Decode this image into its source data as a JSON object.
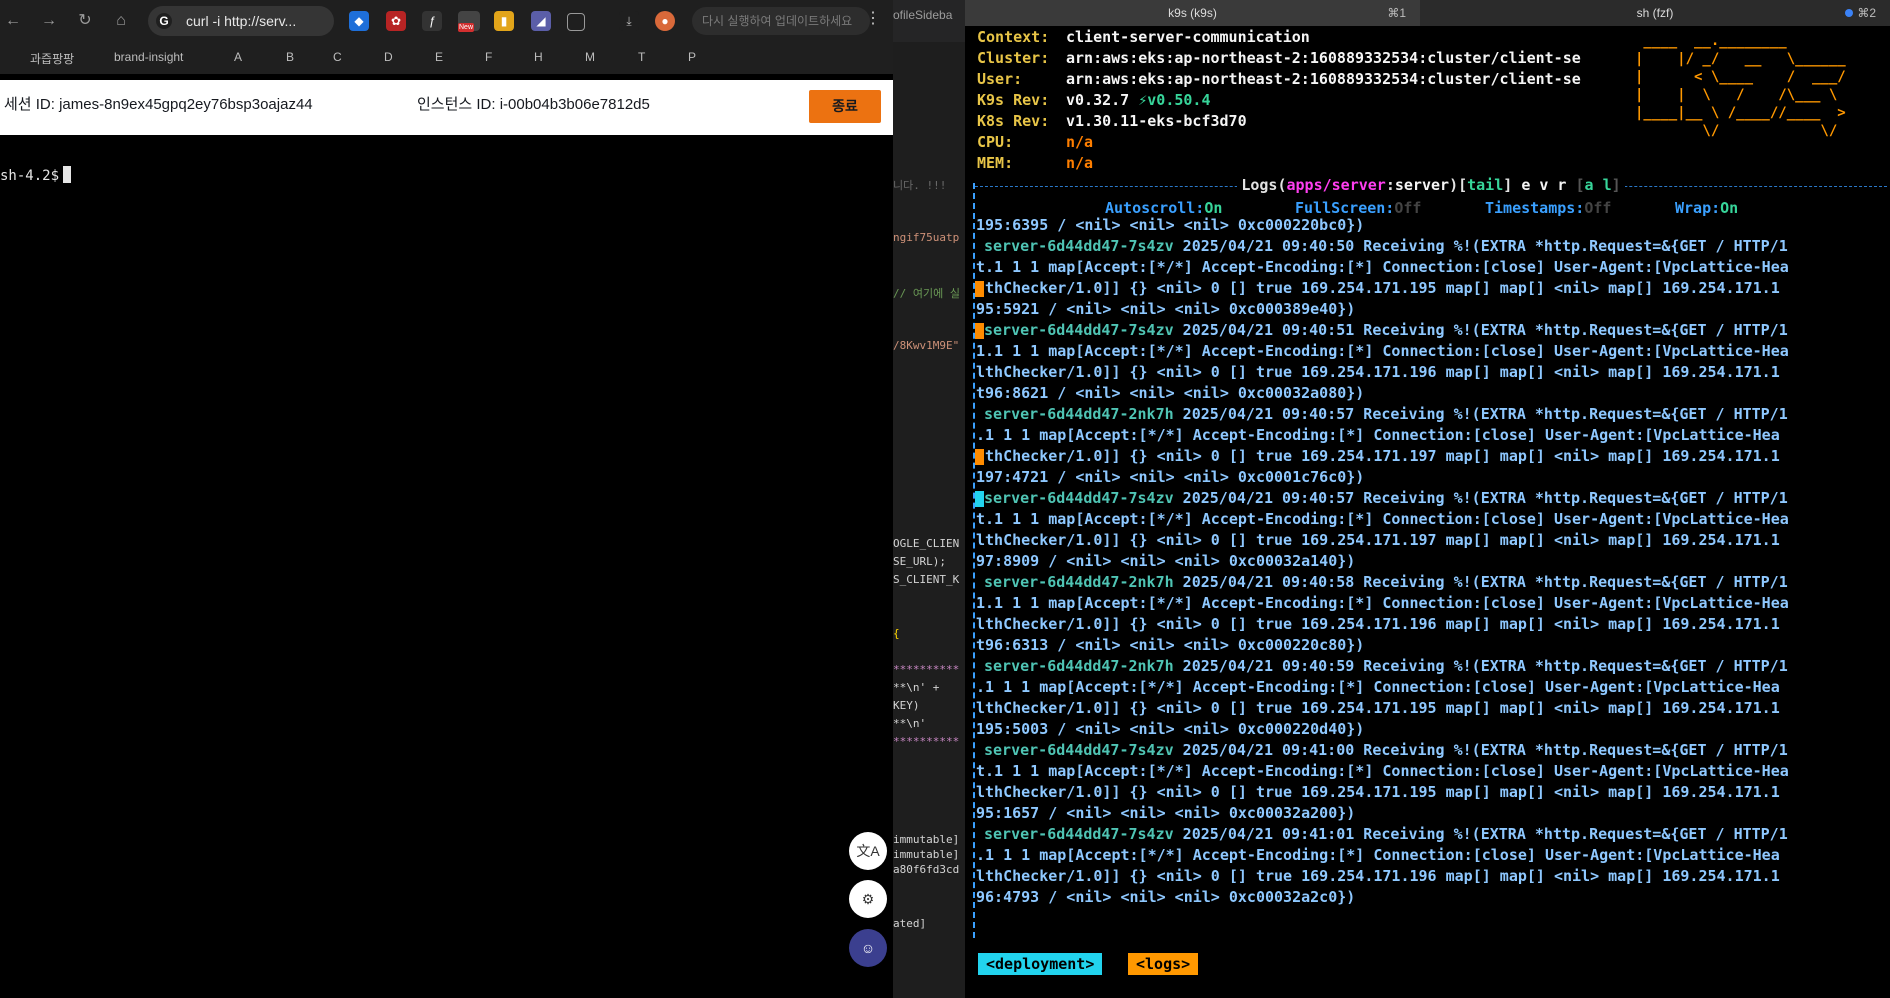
{
  "browser": {
    "address_text": "curl -i http://serv...",
    "ai_search_placeholder": "다시 실행하여 업데이트하세요",
    "bookmarks": [
      "과즙팡팡",
      "brand-insight",
      "A",
      "B",
      "C",
      "D",
      "E",
      "F",
      "H",
      "M",
      "T",
      "P"
    ],
    "new_badge": "New",
    "session_id": "세션 ID: james-8n9ex45gpq2ey76bsp3oajaz44",
    "instance_id": "인스턴스 ID: i-00b04b3b06e7812d5",
    "end_button": "종료",
    "shell_prompt": "sh-4.2$",
    "fab_icons": [
      "translate-icon",
      "extensions-icon",
      "assistant-icon"
    ]
  },
  "editor": {
    "tab_fragment": "ofileSideba",
    "lines": [
      {
        "text": "니다. !!!",
        "color": "#6a6a6a"
      },
      {
        "text": "ngif75uatp",
        "color": "#ce9178"
      },
      {
        "text": "// 여기에 실",
        "color": "#6a9955"
      },
      {
        "text": "/8Kwv1M9E\"",
        "color": "#ce9178"
      },
      {
        "text": "OGLE_CLIEN",
        "color": "#d4d4d4"
      },
      {
        "text": "SE_URL);",
        "color": "#d4d4d4"
      },
      {
        "text": "S_CLIENT_K",
        "color": "#d4d4d4"
      },
      {
        "text": "{",
        "color": "#ffd700"
      },
      {
        "text": "**********",
        "color": "#c586c0"
      },
      {
        "text": "  **\\n' +",
        "color": "#d4d4d4"
      },
      {
        "text": "KEY)",
        "color": "#d4d4d4"
      },
      {
        "text": "    **\\n'",
        "color": "#d4d4d4"
      },
      {
        "text": "**********",
        "color": "#c586c0"
      },
      {
        "text": "immutable]",
        "color": "#d4d4d4"
      },
      {
        "text": "immutable]",
        "color": "#d4d4d4"
      },
      {
        "text": "a80f6fd3cd",
        "color": "#d4d4d4"
      },
      {
        "text": "ated]",
        "color": "#d4d4d4"
      }
    ]
  },
  "terminal": {
    "tabs": [
      {
        "name": "k9s (k9s)",
        "shortcut": "⌘1"
      },
      {
        "name": "sh (fzf)",
        "shortcut": "⌘2"
      }
    ],
    "header": {
      "context_label": "Context:",
      "context": "client-server-communication",
      "cluster_label": "Cluster:",
      "cluster": "arn:aws:eks:ap-northeast-2:160889332534:cluster/client-se",
      "user_label": "User:",
      "user": "arn:aws:eks:ap-northeast-2:160889332534:cluster/client-se",
      "k9s_rev_label": "K9s Rev:",
      "k9s_rev": "v0.32.7",
      "k9s_new_rev": "⚡v0.50.4",
      "k8s_rev_label": "K8s Rev:",
      "k8s_rev": "v1.30.11-eks-bcf3d70",
      "cpu_label": "CPU:",
      "cpu": "n/a",
      "mem_label": "MEM:",
      "mem": "n/a"
    },
    "logo": " ____  __.________\n|    |/ _/   __   \\______\n|      < \\____    /  ___/\n|    |  \\   /    /\\___ \\\n|____|__ \\ /____//____  >\n        \\/            \\/",
    "logs_view": {
      "title_word": "Logs",
      "namespace": "apps/server",
      "container": "server",
      "mode": "tail",
      "flags": "e v r",
      "flags2": "a l",
      "autoscroll_label": "Autoscroll:",
      "autoscroll": "On",
      "fullscreen_label": "FullScreen:",
      "fullscreen": "Off",
      "timestamps_label": "Timestamps:",
      "timestamps": "Off",
      "wrap_label": "Wrap:",
      "wrap": "On"
    },
    "log_lines": [
      {
        "pod": "",
        "text": "195:6395 / <nil> <nil> <nil> 0xc000220bc0})",
        "mark": ""
      },
      {
        "pod": "server-6d44dd47-7s4zv",
        "text": " 2025/04/21 09:40:50 Receiving %!(EXTRA *http.Request=&{GET / HTTP/1",
        "mark": ""
      },
      {
        "pod": "",
        "text": "t.1 1 1 map[Accept:[*/*] Accept-Encoding:[*] Connection:[close] User-Agent:[VpcLattice-Hea",
        "mark": ""
      },
      {
        "pod": "",
        "text": "lthChecker/1.0]] {} <nil> 0 [] true 169.254.171.195 map[] map[] <nil> map[] 169.254.171.1",
        "mark": "#ff8c00"
      },
      {
        "pod": "",
        "text": "95:5921 / <nil> <nil> <nil> 0xc000389e40})",
        "mark": ""
      },
      {
        "pod": "server-6d44dd47-7s4zv",
        "text": " 2025/04/21 09:40:51 Receiving %!(EXTRA *http.Request=&{GET / HTTP/1",
        "mark": "#ff8c00"
      },
      {
        "pod": "",
        "text": "1.1 1 1 map[Accept:[*/*] Accept-Encoding:[*] Connection:[close] User-Agent:[VpcLattice-Hea",
        "mark": ""
      },
      {
        "pod": "",
        "text": "lthChecker/1.0]] {} <nil> 0 [] true 169.254.171.196 map[] map[] <nil> map[] 169.254.171.1",
        "mark": ""
      },
      {
        "pod": "",
        "text": "t96:8621 / <nil> <nil> <nil> 0xc00032a080})",
        "mark": ""
      },
      {
        "pod": "server-6d44dd47-2nk7h",
        "text": " 2025/04/21 09:40:57 Receiving %!(EXTRA *http.Request=&{GET / HTTP/1",
        "mark": ""
      },
      {
        "pod": "",
        "text": ".1 1 1 map[Accept:[*/*] Accept-Encoding:[*] Connection:[close] User-Agent:[VpcLattice-Hea",
        "mark": ""
      },
      {
        "pod": "",
        "text": "lthChecker/1.0]] {} <nil> 0 [] true 169.254.171.197 map[] map[] <nil> map[] 169.254.171.1",
        "mark": "#ff8c00"
      },
      {
        "pod": "",
        "text": "197:4721 / <nil> <nil> <nil> 0xc0001c76c0})",
        "mark": ""
      },
      {
        "pod": "server-6d44dd47-7s4zv",
        "text": " 2025/04/21 09:40:57 Receiving %!(EXTRA *http.Request=&{GET / HTTP/1",
        "mark": "#22d3ee"
      },
      {
        "pod": "",
        "text": "t.1 1 1 map[Accept:[*/*] Accept-Encoding:[*] Connection:[close] User-Agent:[VpcLattice-Hea",
        "mark": ""
      },
      {
        "pod": "",
        "text": "lthChecker/1.0]] {} <nil> 0 [] true 169.254.171.197 map[] map[] <nil> map[] 169.254.171.1",
        "mark": ""
      },
      {
        "pod": "",
        "text": "97:8909 / <nil> <nil> <nil> 0xc00032a140})",
        "mark": ""
      },
      {
        "pod": "server-6d44dd47-2nk7h",
        "text": " 2025/04/21 09:40:58 Receiving %!(EXTRA *http.Request=&{GET / HTTP/1",
        "mark": ""
      },
      {
        "pod": "",
        "text": "1.1 1 1 map[Accept:[*/*] Accept-Encoding:[*] Connection:[close] User-Agent:[VpcLattice-Hea",
        "mark": ""
      },
      {
        "pod": "",
        "text": "lthChecker/1.0]] {} <nil> 0 [] true 169.254.171.196 map[] map[] <nil> map[] 169.254.171.1",
        "mark": ""
      },
      {
        "pod": "",
        "text": "t96:6313 / <nil> <nil> <nil> 0xc000220c80})",
        "mark": ""
      },
      {
        "pod": "server-6d44dd47-2nk7h",
        "text": " 2025/04/21 09:40:59 Receiving %!(EXTRA *http.Request=&{GET / HTTP/1",
        "mark": ""
      },
      {
        "pod": "",
        "text": ".1 1 1 map[Accept:[*/*] Accept-Encoding:[*] Connection:[close] User-Agent:[VpcLattice-Hea",
        "mark": ""
      },
      {
        "pod": "",
        "text": "lthChecker/1.0]] {} <nil> 0 [] true 169.254.171.195 map[] map[] <nil> map[] 169.254.171.1",
        "mark": ""
      },
      {
        "pod": "",
        "text": "195:5003 / <nil> <nil> <nil> 0xc000220d40})",
        "mark": ""
      },
      {
        "pod": "server-6d44dd47-7s4zv",
        "text": " 2025/04/21 09:41:00 Receiving %!(EXTRA *http.Request=&{GET / HTTP/1",
        "mark": ""
      },
      {
        "pod": "",
        "text": "t.1 1 1 map[Accept:[*/*] Accept-Encoding:[*] Connection:[close] User-Agent:[VpcLattice-Hea",
        "mark": ""
      },
      {
        "pod": "",
        "text": "lthChecker/1.0]] {} <nil> 0 [] true 169.254.171.195 map[] map[] <nil> map[] 169.254.171.1",
        "mark": ""
      },
      {
        "pod": "",
        "text": "95:1657 / <nil> <nil> <nil> 0xc00032a200})",
        "mark": ""
      },
      {
        "pod": "server-6d44dd47-7s4zv",
        "text": " 2025/04/21 09:41:01 Receiving %!(EXTRA *http.Request=&{GET / HTTP/1",
        "mark": ""
      },
      {
        "pod": "",
        "text": ".1 1 1 map[Accept:[*/*] Accept-Encoding:[*] Connection:[close] User-Agent:[VpcLattice-Hea",
        "mark": ""
      },
      {
        "pod": "",
        "text": "lthChecker/1.0]] {} <nil> 0 [] true 169.254.171.196 map[] map[] <nil> map[] 169.254.171.1",
        "mark": ""
      },
      {
        "pod": "",
        "text": "96:4793 / <nil> <nil> <nil> 0xc00032a2c0})",
        "mark": ""
      }
    ],
    "crumbs": [
      {
        "label": "<deployment>",
        "color": "#22d3ee"
      },
      {
        "label": "<logs>",
        "color": "#ff9800"
      }
    ]
  },
  "colors": {
    "accent_orange": "#ec7211",
    "k9s_yellow": "#e8c547",
    "k9s_cyan": "#22d3ee"
  }
}
